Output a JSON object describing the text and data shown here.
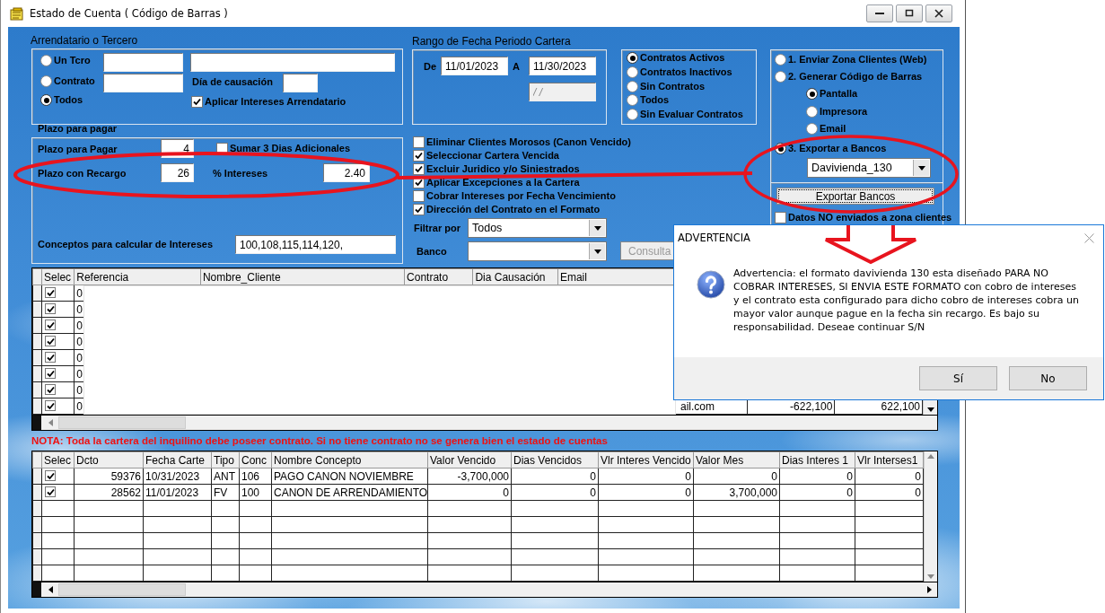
{
  "window": {
    "title": "Estado de Cuenta ( Código de Barras )"
  },
  "tercero": {
    "label": "Arrendatario o Tercero",
    "options": [
      {
        "label": "Un Tcro",
        "selected": false
      },
      {
        "label": "Contrato",
        "selected": false
      },
      {
        "label": "Todos",
        "selected": true
      }
    ],
    "dia_label": "Día de causación",
    "aplicar": {
      "label": "Aplicar Intereses Arrendatario",
      "checked": true
    }
  },
  "plazo": {
    "label": "Plazo para pagar",
    "pagar_label": "Plazo para Pagar",
    "pagar_value": "4",
    "sumar": {
      "label": "Sumar 3 Dias Adicionales",
      "checked": false
    },
    "recargo_label": "Plazo con Recargo",
    "recargo_value": "26",
    "intereses_label": "% Intereses",
    "intereses_value": "2.40",
    "conceptos_label": "Conceptos para calcular de Intereses",
    "conceptos_value": "100,108,115,114,120,"
  },
  "rango": {
    "label": "Rango de Fecha Periodo Cartera",
    "de_label": "De",
    "de_value": "11/01/2023",
    "a_label": "A",
    "a_value": "11/30/2023",
    "extra_value": "/ /"
  },
  "contratos": [
    {
      "label": "Contratos Activos",
      "selected": true
    },
    {
      "label": "Contratos Inactivos",
      "selected": false
    },
    {
      "label": "Sin Contratos",
      "selected": false
    },
    {
      "label": "Todos",
      "selected": false
    },
    {
      "label": "Sin Evaluar Contratos",
      "selected": false
    }
  ],
  "salida": [
    {
      "label": "1. Enviar Zona Clientes (Web)",
      "selected": false
    },
    {
      "label": "2. Generar Código de Barras",
      "selected": false,
      "children": [
        {
          "label": "Pantalla",
          "selected": true
        },
        {
          "label": "Impresora",
          "selected": false
        },
        {
          "label": "Email",
          "selected": false
        }
      ]
    },
    {
      "label": "3. Exportar a Bancos",
      "selected": true
    }
  ],
  "banco_export": "Davivienda_130",
  "export_button": "Exportar Bancos",
  "no_enviados": {
    "label": "Datos NO enviados a zona clientes",
    "checked": false
  },
  "opciones": [
    {
      "label": "Eliminar Clientes Morosos (Canon Vencido)",
      "checked": false
    },
    {
      "label": "Seleccionar Cartera Vencida",
      "checked": true
    },
    {
      "label": "Excluir Juridico y/o Siniestrados",
      "checked": true
    },
    {
      "label": "Aplicar Excepciones a la Cartera",
      "checked": true
    },
    {
      "label": "Cobrar Intereses por Fecha Vencimiento",
      "checked": false
    },
    {
      "label": "Dirección del Contrato en el Formato",
      "checked": true
    }
  ],
  "filtrar": {
    "label": "Filtrar por",
    "value": "Todos"
  },
  "banco": {
    "label": "Banco"
  },
  "consulta_button": "Consulta",
  "clientes_table": {
    "select_column": "Selec",
    "columns": [
      "Referencia",
      "Nombre_Cliente",
      "Contrato",
      "Dia Causación",
      "Email"
    ],
    "rows": [
      {
        "checked": true,
        "referencia": "0"
      },
      {
        "checked": true,
        "referencia": "0"
      },
      {
        "checked": true,
        "referencia": "0"
      },
      {
        "checked": true,
        "referencia": "0"
      },
      {
        "checked": true,
        "referencia": "0"
      },
      {
        "checked": true,
        "referencia": "0"
      },
      {
        "checked": true,
        "referencia": "0"
      },
      {
        "checked": true,
        "referencia": "0",
        "email": "ail.com",
        "column_7": "-622,100",
        "column_8": "622,100"
      }
    ]
  },
  "nota": "NOTA: Toda la cartera del inquilino debe poseer contrato. Si no tiene contrato no se genera bien el estado de cuentas",
  "conceptos_table": {
    "select_column": "Selec",
    "columns": [
      "Dcto",
      "Fecha Carte",
      "Tipo",
      "Conc",
      "Nombre Concepto",
      "Valor Vencido",
      "Dias Vencidos",
      "Vlr Interes Vencido",
      "Valor Mes",
      "Dias Interes 1",
      "Vlr Interses1"
    ],
    "rows": [
      {
        "checked": true,
        "cells": [
          "59376",
          "10/31/2023",
          "ANT",
          "106",
          "PAGO CANON NOVIEMBRE",
          "-3,700,000",
          "0",
          "0",
          "0",
          "0",
          "0"
        ]
      },
      {
        "checked": true,
        "cells": [
          "28562",
          "11/01/2023",
          "FV",
          "100",
          "CANON DE ARRENDAMIENTO",
          "0",
          "0",
          "0",
          "3,700,000",
          "0",
          "0"
        ]
      }
    ]
  },
  "dialog": {
    "title": "ADVERTENCIA",
    "message": "Advertencia: el formato davivienda 130 esta diseñado PARA NO COBRAR INTERESES, SI ENVIA ESTE FORMATO con cobro de intereses y el contrato esta configurado para dicho cobro de intereses cobra un mayor valor aunque pague en la fecha sin recargo. Es bajo su responsabilidad. Deseae continuar S/N",
    "buttons": [
      "Sí",
      "No"
    ]
  }
}
